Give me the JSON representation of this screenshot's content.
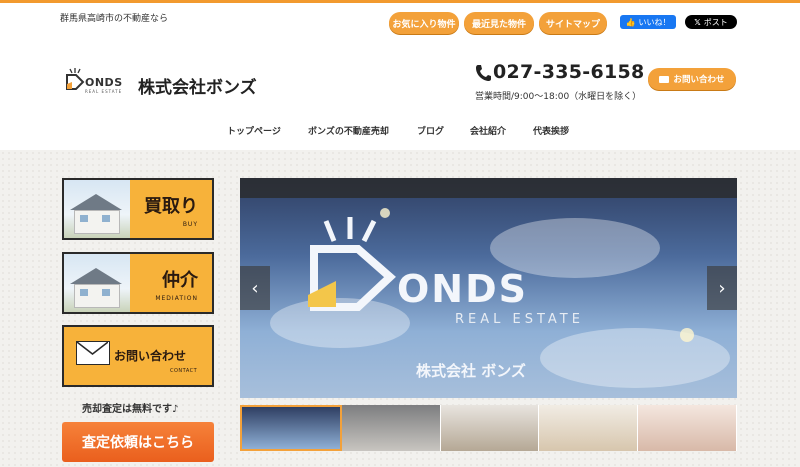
{
  "header": {
    "tagline": "群馬県高崎市の不動産なら",
    "buttons": [
      "お気に入り物件",
      "最近見た物件",
      "サイトマップ"
    ],
    "facebook_like": "いいね！",
    "x_post": "ポスト"
  },
  "brand": {
    "logo_text": "ONDS",
    "logo_sub": "REAL ESTATE",
    "company_name": "株式会社ボンズ"
  },
  "contact": {
    "phone": "027-335-6158",
    "hours": "営業時間/9:00～18:00（水曜日を除く）",
    "button_label": "お問い合わせ"
  },
  "nav": {
    "items": [
      "トップページ",
      "ボンズの不動産売却",
      "ブログ",
      "会社紹介",
      "代表挨拶"
    ]
  },
  "sidebar": {
    "cards": [
      {
        "title": "買取り",
        "sub": "BUY"
      },
      {
        "title": "仲介",
        "sub": "MEDIATION"
      },
      {
        "title": "お問い合わせ",
        "sub": "CONTACT"
      }
    ],
    "free_text": "売却査定は無料です♪",
    "request_button": "査定依頼はこちら"
  },
  "slider": {
    "logo_word": "ONDS",
    "logo_sub": "REAL ESTATE",
    "company": "株式会社 ボンズ",
    "prev": "‹",
    "next": "›"
  },
  "colors": {
    "accent": "#f3a13a",
    "card": "#f7b23a",
    "request": "#ea5f1d"
  }
}
